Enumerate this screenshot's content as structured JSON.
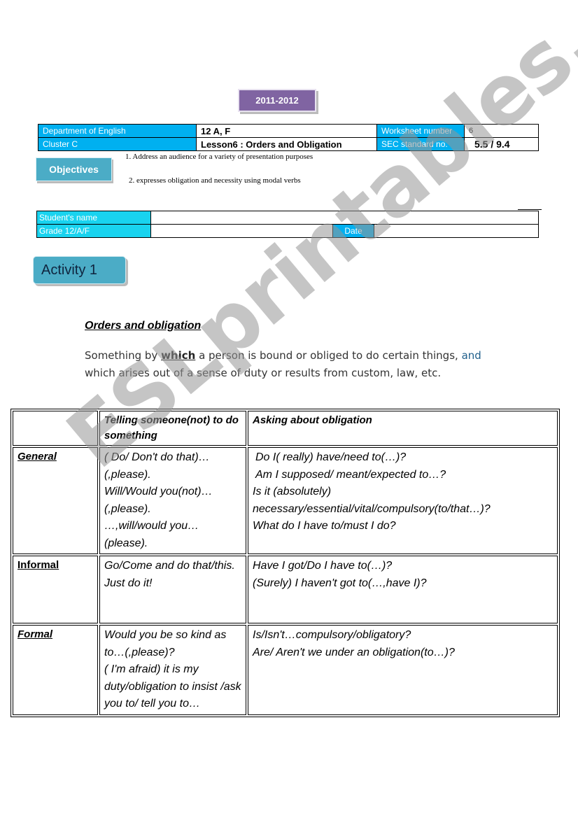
{
  "header": {
    "year": "2011-2012",
    "department_label": "Department of English",
    "cluster_label": "Cluster  C",
    "class_value": "12 A, F",
    "lesson_value": "Lesson6 : Orders and Obligation",
    "worksheet_label": "Worksheet number",
    "worksheet_value": "6",
    "sec_label": "SEC standard no.",
    "sec_value": "5.5 / 9.4"
  },
  "objectives": {
    "label": "Objectives",
    "items": [
      "1. Address an audience for a variety of presentation purposes",
      "2. expresses obligation and necessity using modal verbs"
    ]
  },
  "student": {
    "name_label": "Student's name",
    "name_value": "",
    "grade_label": "Grade 12/A/F",
    "grade_value": "",
    "date_label": "Date",
    "date_value": ""
  },
  "activity": {
    "label": "Activity 1"
  },
  "section": {
    "title": "Orders  and obligation",
    "definition_part1": "Something by ",
    "definition_keyword": "which",
    "definition_part2": " a person is bound or obliged to do certain things, ",
    "definition_and": "and",
    "definition_part3": " which arises out of a sense of duty or results from custom, law, etc."
  },
  "table": {
    "headers": [
      "",
      "Telling someone(not) to do something",
      "Asking about obligation"
    ],
    "rows": [
      {
        "label": "General",
        "telling": [
          "( Do/ Don't do that)…(,please).",
          "Will/Would you(not)…(,please).",
          "…,will/would you…(please)."
        ],
        "asking": [
          " Do I( really) have/need to(…)?",
          " Am I supposed/ meant/expected to…?",
          " Is it (absolutely) necessary/essential/vital/compulsory(to/that…)?",
          "What do I have to/must I do?"
        ]
      },
      {
        "label": "Informal",
        "telling": [
          "Go/Come and do that/this.",
          "Just do it!"
        ],
        "asking": [
          "Have I got/Do I have to(…)?",
          "(Surely) I haven't got to(…,have I)?"
        ]
      },
      {
        "label": "Formal",
        "telling": [
          "Would you be so kind as to…(,please)?",
          "( I'm afraid) it is my duty/obligation to insist /ask you to/ tell you to…"
        ],
        "asking": [
          "Is/Isn't…compulsory/obligatory?",
          "Are/ Aren't we under an obligation(to…)?"
        ]
      }
    ]
  },
  "watermark": "ESLprintables.com"
}
